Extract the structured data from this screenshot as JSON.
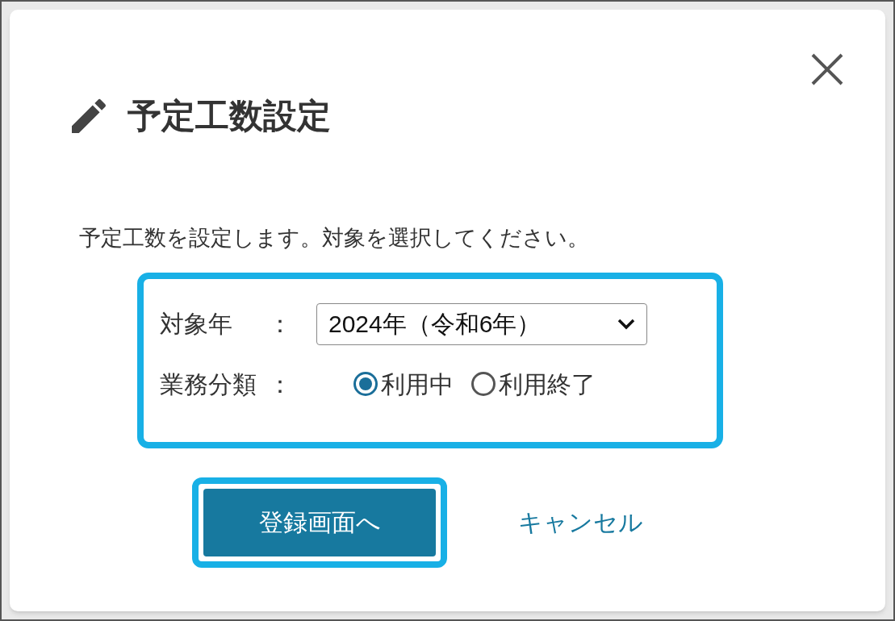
{
  "dialog": {
    "title": "予定工数設定",
    "description": "予定工数を設定します。対象を選択してください。",
    "fields": [
      {
        "kind": "select",
        "label": "対象年",
        "separator": "：",
        "value": "2024年（令和6年）"
      },
      {
        "kind": "radio",
        "label": "業務分類",
        "separator": "：",
        "options": [
          {
            "label": "利用中",
            "selected": true
          },
          {
            "label": "利用終了",
            "selected": false
          }
        ]
      }
    ],
    "primary_button": "登録画面へ",
    "cancel_link": "キャンセル"
  }
}
